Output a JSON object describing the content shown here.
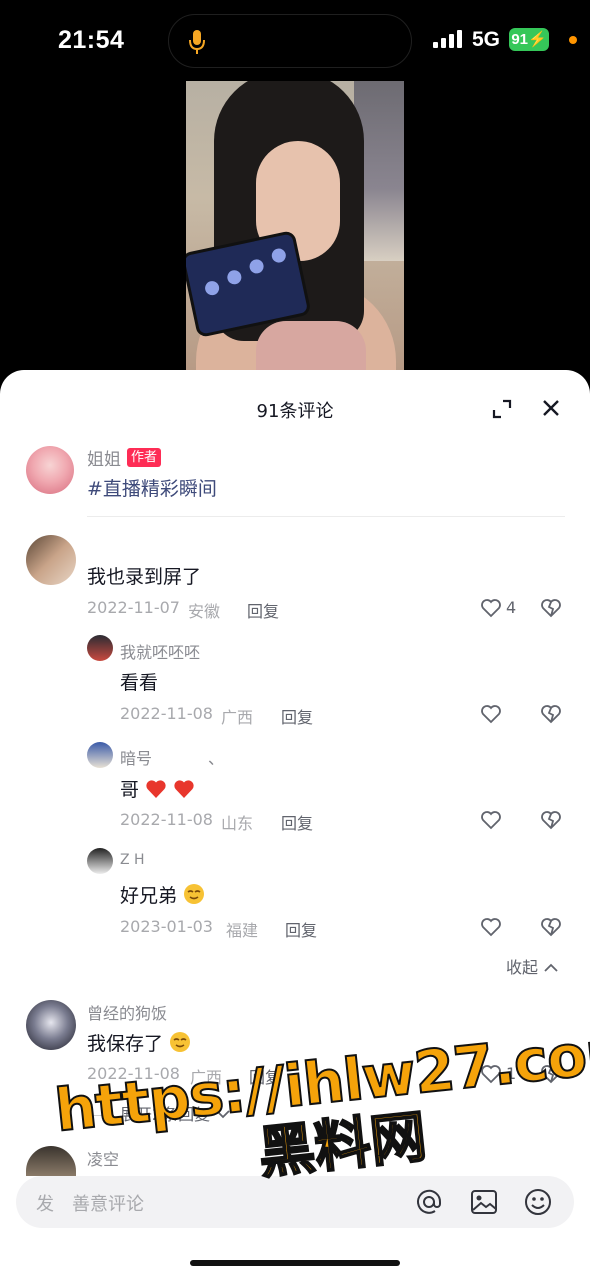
{
  "status": {
    "time": "21:54",
    "network": "5G",
    "battery": "91"
  },
  "sheet": {
    "title": "91条评论",
    "author": {
      "name": "姐姐",
      "badge": "作者",
      "text": "#直播精彩瞬间"
    },
    "comments": [
      {
        "text": "我也录到屏了",
        "date": "2022-11-07",
        "location": "安徽",
        "reply_label": "回复",
        "likes": "4",
        "replies": [
          {
            "name": "我就呸呸呸",
            "text": "看看",
            "date": "2022-11-08",
            "location": "广西",
            "reply_label": "回复"
          },
          {
            "name": "暗号",
            "extra": "、",
            "text": "哥",
            "date": "2022-11-08",
            "location": "山东",
            "reply_label": "回复"
          },
          {
            "name": "Z H",
            "text": "好兄弟",
            "date": "2023-01-03",
            "location": "福建",
            "reply_label": "回复"
          }
        ]
      },
      {
        "name": "曾经的狗饭",
        "text": "我保存了",
        "date": "2022-11-08",
        "location": "广西",
        "reply_label": "回复",
        "likes": "1"
      },
      {
        "name": "凌空"
      }
    ],
    "collapse_label": "收起",
    "expand_label": "展开2条回复",
    "input_placeholder": "发",
    "input_placeholder_2": "善意评论"
  },
  "watermark": {
    "url": "https://ihlw27.com",
    "site": "黑料网"
  },
  "colors": {
    "accent": "#fe2c55",
    "hashtag": "#3e4a7a",
    "battery": "#35c759",
    "watermark": "#f5a30a"
  },
  "icons": [
    "mic-icon",
    "signal-icon",
    "expand-icon",
    "close-icon",
    "heart-icon",
    "broken-heart-icon",
    "chevron-up-icon",
    "chevron-down-icon",
    "at-icon",
    "image-icon",
    "emoji-icon"
  ]
}
